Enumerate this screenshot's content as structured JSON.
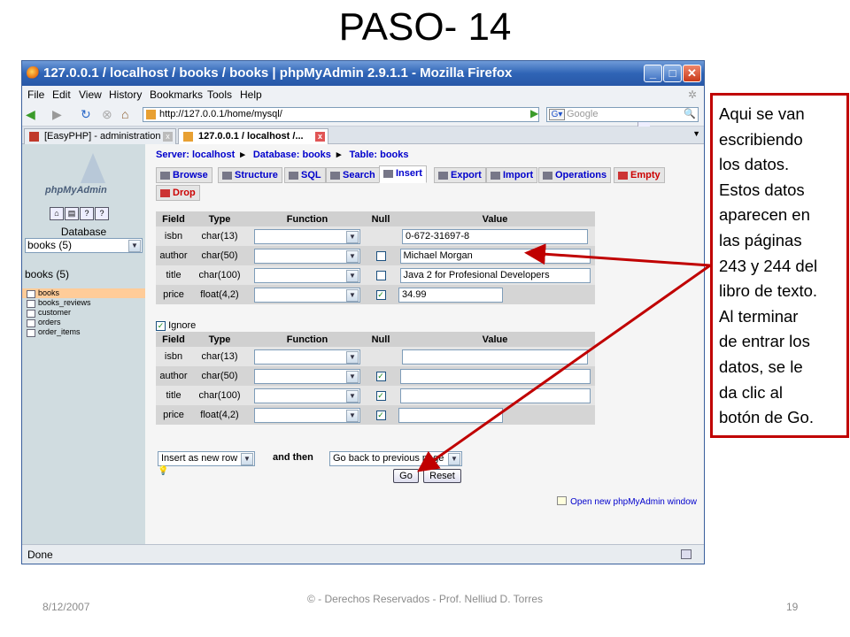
{
  "slide": {
    "title": "PASO- 14",
    "callout_lines": [
      "Aqui se van",
      "escribiendo",
      "los datos.",
      "Estos datos",
      "aparecen en",
      "las páginas",
      "243 y 244 del",
      "libro de texto.",
      "Al terminar",
      "de entrar los",
      "datos, se le",
      "da clic al",
      "botón de Go."
    ],
    "footer_date": "8/12/2007",
    "footer_copy": "© - Derechos Reservados  - Prof. Nelliud D. Torres",
    "page_number": "19",
    "accent_color": "#c00000"
  },
  "browser": {
    "window_title": "127.0.0.1 / localhost / books / books | phpMyAdmin 2.9.1.1 - Mozilla Firefox",
    "menu": [
      "File",
      "Edit",
      "View",
      "History",
      "Bookmarks",
      "Tools",
      "Help"
    ],
    "url": "http://127.0.0.1/home/mysql/",
    "search_placeholder": "Google",
    "tabs": [
      "[EasyPHP] - administration",
      "127.0.0.1 / localhost /..."
    ],
    "status": "Done"
  },
  "pma": {
    "logo": "phpMyAdmin",
    "database_label": "Database",
    "database_select": "books (5)",
    "books_count": "books (5)",
    "tables": [
      "books",
      "books_reviews",
      "customer",
      "orders",
      "order_items"
    ],
    "breadcrumb": {
      "server": "Server: localhost",
      "database": "Database: books",
      "table": "Table: books"
    },
    "tabs": [
      "Browse",
      "Structure",
      "SQL",
      "Search",
      "Insert",
      "Export",
      "Import",
      "Operations",
      "Empty",
      "Drop"
    ],
    "headers": [
      "Field",
      "Type",
      "Function",
      "Null",
      "Value"
    ],
    "rows1": [
      {
        "field": "isbn",
        "type": "char(13)",
        "null": false,
        "has_null": false,
        "value": "0-672-31697-8"
      },
      {
        "field": "author",
        "type": "char(50)",
        "null": false,
        "has_null": true,
        "value": "Michael Morgan"
      },
      {
        "field": "title",
        "type": "char(100)",
        "null": false,
        "has_null": true,
        "value": "Java 2 for Profesional Developers"
      },
      {
        "field": "price",
        "type": "float(4,2)",
        "null": true,
        "has_null": true,
        "value": "34.99"
      }
    ],
    "ignore_label": "Ignore",
    "rows2": [
      {
        "field": "isbn",
        "type": "char(13)",
        "null": false,
        "has_null": false,
        "value": ""
      },
      {
        "field": "author",
        "type": "char(50)",
        "null": true,
        "has_null": true,
        "value": ""
      },
      {
        "field": "title",
        "type": "char(100)",
        "null": true,
        "has_null": true,
        "value": ""
      },
      {
        "field": "price",
        "type": "float(4,2)",
        "null": true,
        "has_null": true,
        "value": ""
      }
    ],
    "insert_mode": "Insert as new row",
    "and_then": "and then",
    "after_action": "Go back to previous page",
    "go_label": "Go",
    "reset_label": "Reset",
    "open_new_window": "Open new phpMyAdmin window"
  }
}
